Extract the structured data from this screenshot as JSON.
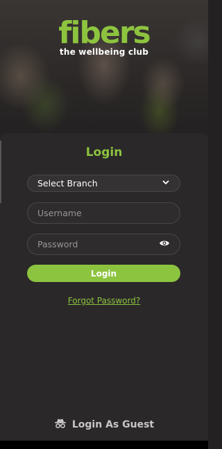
{
  "brand": {
    "name": "fibers",
    "tagline": "the wellbeing club",
    "accent": "#8dc43f"
  },
  "login": {
    "title": "Login",
    "branch_select": {
      "value": "Select Branch",
      "icon": "chevron-down-icon"
    },
    "username": {
      "placeholder": "Username",
      "value": ""
    },
    "password": {
      "placeholder": "Password",
      "value": "",
      "icon": "eye-icon"
    },
    "submit_label": "Login",
    "forgot_label": "Forgot Password?"
  },
  "guest": {
    "label": "Login As Guest",
    "icon": "incognito-icon"
  }
}
